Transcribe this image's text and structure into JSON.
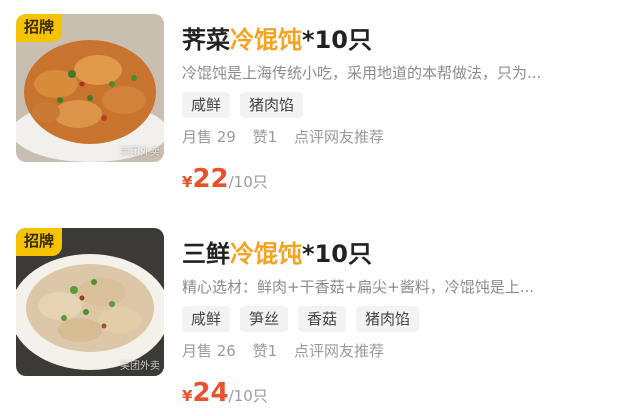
{
  "items": [
    {
      "badge": "招牌",
      "name_prefix": "荠菜",
      "name_highlight": "冷馄饨",
      "name_suffix": "*10只",
      "description": "冷馄饨是上海传统小吃，采用地道的本帮做法，只为...",
      "tags": [
        "咸鲜",
        "猪肉馅"
      ],
      "sales": "月售 29",
      "likes": "赞1",
      "recommend": "点评网友推荐",
      "currency": "¥",
      "price": "22",
      "unit": "/10只",
      "watermark": "美团外卖"
    },
    {
      "badge": "招牌",
      "name_prefix": "三鲜",
      "name_highlight": "冷馄饨",
      "name_suffix": "*10只",
      "description": "精心选材：鲜肉+干香菇+扁尖+酱料，冷馄饨是上...",
      "tags": [
        "咸鲜",
        "笋丝",
        "香菇",
        "猪肉馅"
      ],
      "sales": "月售 26",
      "likes": "赞1",
      "recommend": "点评网友推荐",
      "currency": "¥",
      "price": "24",
      "unit": "/10只",
      "watermark": "美团外卖"
    }
  ],
  "colors": {
    "accent": "#f6a320",
    "price": "#e8512c",
    "badge": "#f5c400"
  }
}
